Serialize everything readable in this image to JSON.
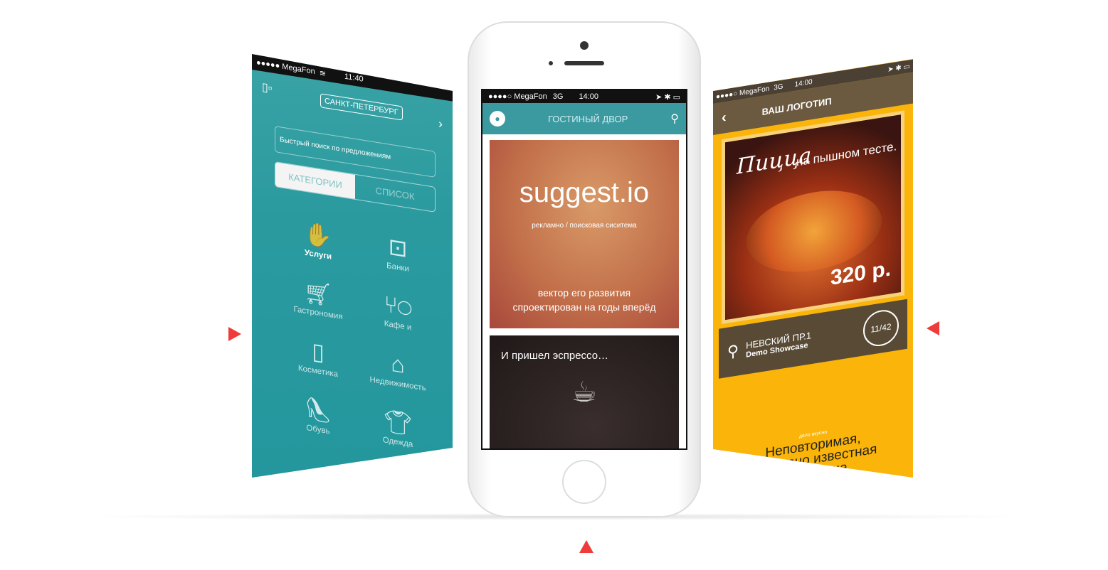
{
  "left_screen": {
    "status": {
      "carrier": "●●●●● MegaFon",
      "time": "11:40"
    },
    "city": "САНКТ-ПЕТЕРБУРГ",
    "search_placeholder": "Быстрый поиск по предложениям",
    "tabs": [
      "КАТЕГОРИИ",
      "СПИСОК"
    ],
    "categories": [
      {
        "label": "Услуги",
        "icon": "hand-icon"
      },
      {
        "label": "Банки",
        "icon": "safe-icon"
      },
      {
        "label": "Гастрономия",
        "icon": "cart-icon"
      },
      {
        "label": "Кафе и",
        "icon": "cutlery-icon"
      },
      {
        "label": "Косметика",
        "icon": "lipstick-icon"
      },
      {
        "label": "Недвижимость",
        "icon": "house-icon"
      },
      {
        "label": "Обувь",
        "icon": "shoe-icon"
      },
      {
        "label": "Одежда",
        "icon": "shirt-icon"
      }
    ]
  },
  "center_screen": {
    "status": {
      "carrier": "●●●●○ MegaFon",
      "network": "3G",
      "time": "14:00"
    },
    "title": "ГОСТИНЫЙ ДВОР",
    "card1": {
      "brand": "suggest.io",
      "subtitle": "рекламно / поисковая сиситема",
      "tagline": "вектор его развития спроектирован на годы вперёд"
    },
    "card2": {
      "title": "И пришел эспрессо…"
    }
  },
  "right_screen": {
    "status": {
      "carrier": "●●●●○ MegaFon",
      "network": "3G",
      "time": "14:00"
    },
    "title": "ВАШ ЛОГОТИП",
    "promo": {
      "script": "Пицца",
      "headline": "на пышном тесте.",
      "price": "320 р."
    },
    "address": "НЕВСКИЙ ПР.1",
    "shop": "Demo Showcase",
    "counter": "11/42",
    "small_label": "дело вкусно",
    "description": "Неповторимая, всемирно известная Пан Пицца"
  },
  "colors": {
    "accent": "#ef3b3b",
    "teal": "#2a9a9f",
    "yellow": "#fbb40a"
  }
}
